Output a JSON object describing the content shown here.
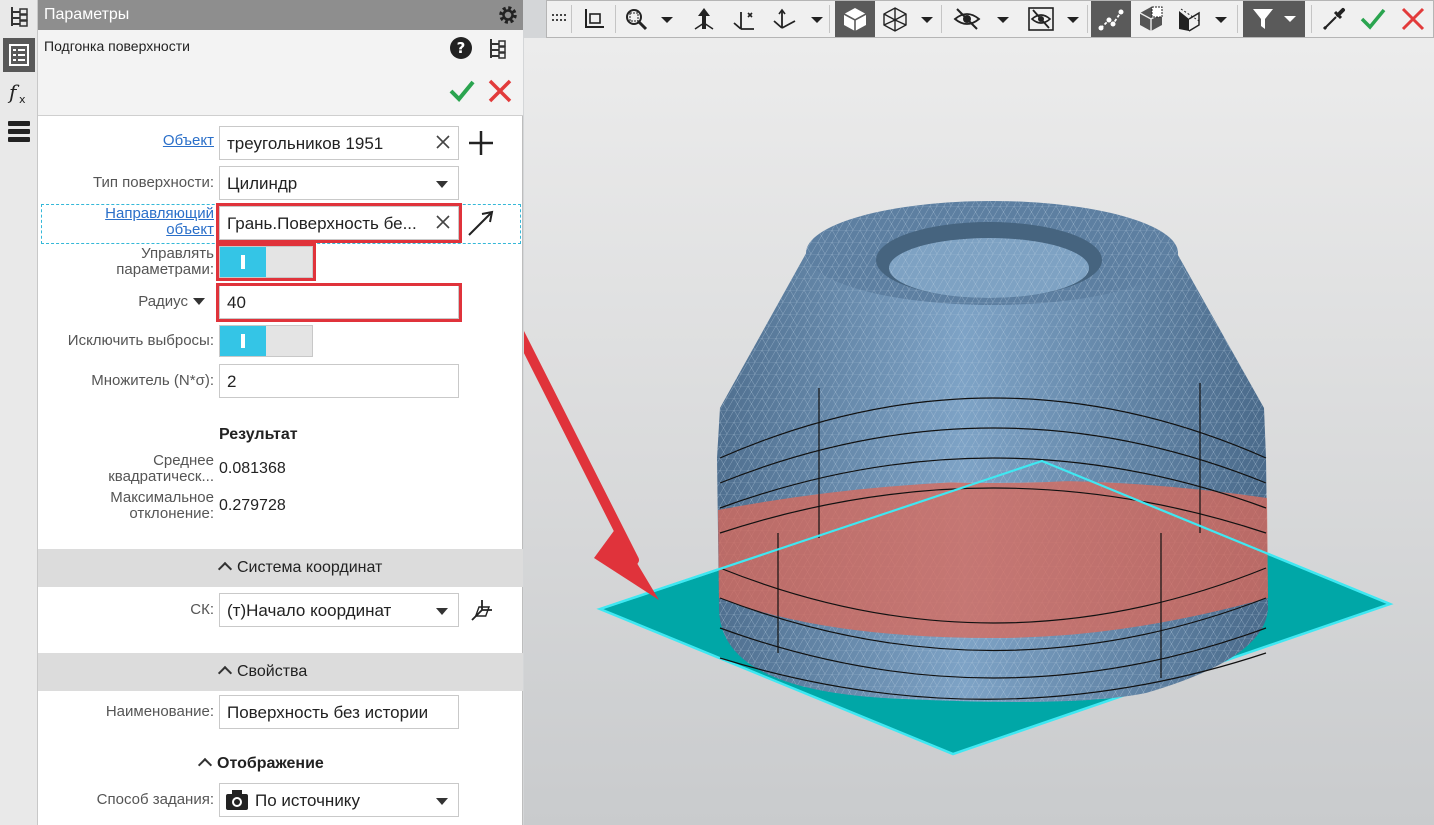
{
  "panel": {
    "title": "Параметры",
    "command": "Подгонка поверхности"
  },
  "form": {
    "object_label": "Объект",
    "object_value": "треугольников 1951",
    "surface_type_label": "Тип поверхности:",
    "surface_type_value": "Цилиндр",
    "guide_label_1": "Направляющий",
    "guide_label_2": "объект",
    "guide_value": "Грань.Поверхность бе...",
    "manage_label_1": "Управлять",
    "manage_label_2": "параметрами:",
    "manage_params_on": true,
    "radius_label": "Радиус",
    "radius_value": "40",
    "exclude_label": "Исключить выбросы:",
    "exclude_on": true,
    "multiplier_label": "Множитель (N*σ):",
    "multiplier_value": "2"
  },
  "result": {
    "heading": "Результат",
    "rms_label_1": "Среднее",
    "rms_label_2": "квадратическ...",
    "rms_value": "0.081368",
    "max_label_1": "Максимальное",
    "max_label_2": "отклонение:",
    "max_value": "0.279728"
  },
  "coords": {
    "heading": "Система координат",
    "cs_label": "СК:",
    "cs_value": "(т)Начало координат"
  },
  "props": {
    "heading": "Свойства",
    "name_label": "Наименование:",
    "name_value": "Поверхность без истории"
  },
  "display": {
    "heading": "Отображение",
    "method_label": "Способ задания:",
    "method_value": "По источнику"
  },
  "colors": {
    "accent": "#34c5e6",
    "highlight": "#e0333b",
    "ok": "#2aa44f",
    "cancel": "#e23b3b",
    "model": "#6a8fb3",
    "plane": "#00a8a8"
  },
  "icons": {
    "strip": [
      "tree-icon",
      "parameters-icon",
      "formula-icon",
      "layers-icon"
    ],
    "toolbar": [
      "grip-icon",
      "coordinate-system-icon",
      "zoom-icon",
      "orient-icon",
      "axes-icon",
      "triad-icon",
      "shaded-cube-icon",
      "wireframe-cube-icon",
      "hide-icon",
      "hide-objects-icon",
      "hidden-lines-icon",
      "section-icon",
      "layers-view-icon",
      "filter-icon",
      "eyedropper-icon",
      "ok-icon",
      "cancel-icon"
    ]
  }
}
